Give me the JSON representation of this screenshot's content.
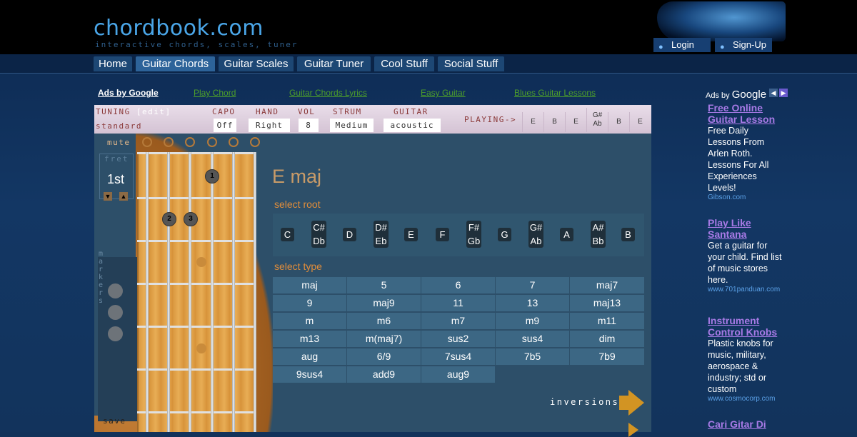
{
  "header": {
    "logo": "chordbook.com",
    "tagline": "interactive chords, scales, tuner",
    "login_label": "Login",
    "signup_label": "Sign-Up",
    "user_icon": "user-icon"
  },
  "nav": {
    "tabs": [
      {
        "label": "Home",
        "active": false
      },
      {
        "label": "Guitar Chords",
        "active": true
      },
      {
        "label": "Guitar Scales",
        "active": false
      },
      {
        "label": "Guitar Tuner",
        "active": false
      },
      {
        "label": "Cool Stuff",
        "active": false
      },
      {
        "label": "Social Stuff",
        "active": false
      }
    ]
  },
  "ad_links": {
    "ads_by_google": "Ads by Google",
    "links": [
      "Play Chord",
      "Guitar Chords Lyrics",
      "Easy Guitar",
      "Blues Guitar Lessons"
    ]
  },
  "settings": {
    "tuning_label": "TUNING",
    "tuning_edit": "[edit]",
    "tuning_value": "standard",
    "capo_label": "CAPO",
    "capo_value": "Off",
    "hand_label": "HAND",
    "hand_value": "Right",
    "vol_label": "VOL",
    "vol_value": "8",
    "strum_label": "STRUM",
    "strum_value": "Medium",
    "guitar_label": "GUITAR",
    "guitar_value": "acoustic",
    "playing_label": "PLAYING->",
    "playing_strings": [
      {
        "top": "E",
        "bottom": ""
      },
      {
        "top": "B",
        "bottom": ""
      },
      {
        "top": "E",
        "bottom": ""
      },
      {
        "top": "G#",
        "bottom": "Ab"
      },
      {
        "top": "B",
        "bottom": ""
      },
      {
        "top": "E",
        "bottom": ""
      }
    ]
  },
  "fretboard": {
    "mute_label": "mute",
    "fret_label": "fret",
    "fret_value": "1st",
    "markers_label": "markers",
    "save_label": "save",
    "fingers": [
      "1",
      "2",
      "3"
    ]
  },
  "chord": {
    "name": "E maj",
    "select_root_label": "select root",
    "roots": [
      {
        "top": "C",
        "bottom": ""
      },
      {
        "top": "C#",
        "bottom": "Db"
      },
      {
        "top": "D",
        "bottom": ""
      },
      {
        "top": "D#",
        "bottom": "Eb"
      },
      {
        "top": "E",
        "bottom": ""
      },
      {
        "top": "F",
        "bottom": ""
      },
      {
        "top": "F#",
        "bottom": "Gb"
      },
      {
        "top": "G",
        "bottom": ""
      },
      {
        "top": "G#",
        "bottom": "Ab"
      },
      {
        "top": "A",
        "bottom": ""
      },
      {
        "top": "A#",
        "bottom": "Bb"
      },
      {
        "top": "B",
        "bottom": ""
      }
    ],
    "select_type_label": "select type",
    "types": [
      [
        "maj",
        "5",
        "6",
        "7",
        "maj7"
      ],
      [
        "9",
        "maj9",
        "11",
        "13",
        "maj13"
      ],
      [
        "m",
        "m6",
        "m7",
        "m9",
        "m11"
      ],
      [
        "m13",
        "m(maj7)",
        "sus2",
        "sus4",
        "dim"
      ],
      [
        "aug",
        "6/9",
        "7sus4",
        "7b5",
        "7b9"
      ],
      [
        "9sus4",
        "add9",
        "aug9"
      ]
    ],
    "inversions_label": "inversions"
  },
  "right_ads": {
    "ads_by": "Ads by",
    "google": "Google",
    "items": [
      {
        "title_lines": [
          "Free Online",
          "Guitar Lesson"
        ],
        "desc_lines": [
          "Free Daily",
          "Lessons From",
          "Arlen Roth.",
          "Lessons For All",
          "Experiences",
          "Levels!"
        ],
        "domain": "Gibson.com"
      },
      {
        "title_lines": [
          "Play Like",
          "Santana"
        ],
        "desc_lines": [
          "Get a guitar for",
          "your child. Find list",
          "of music stores",
          "here."
        ],
        "domain": "www.701panduan.com"
      },
      {
        "title_lines": [
          "Instrument",
          "Control Knobs"
        ],
        "desc_lines": [
          "Plastic knobs for",
          "music, military,",
          "aerospace &",
          "industry; std or",
          "custom"
        ],
        "domain": "www.cosmocorp.com"
      },
      {
        "title_lines": [
          "Cari Gitar Di"
        ],
        "desc_lines": [],
        "domain": ""
      }
    ]
  },
  "colors": {
    "background": "#12325a",
    "header_bg": "#000000",
    "logo_blue": "#4aa6e8",
    "tab_bg": "#1d4774",
    "tab_active_bg": "#2d6399",
    "panel": "#2d4f69",
    "type_cell": "#3c6784",
    "orange_label": "#e18d3a",
    "chord_name": "#c89b68",
    "ad_link_green": "#4d9e2a",
    "ad_title_purple": "#a77ae6",
    "arrow": "#d29423"
  }
}
